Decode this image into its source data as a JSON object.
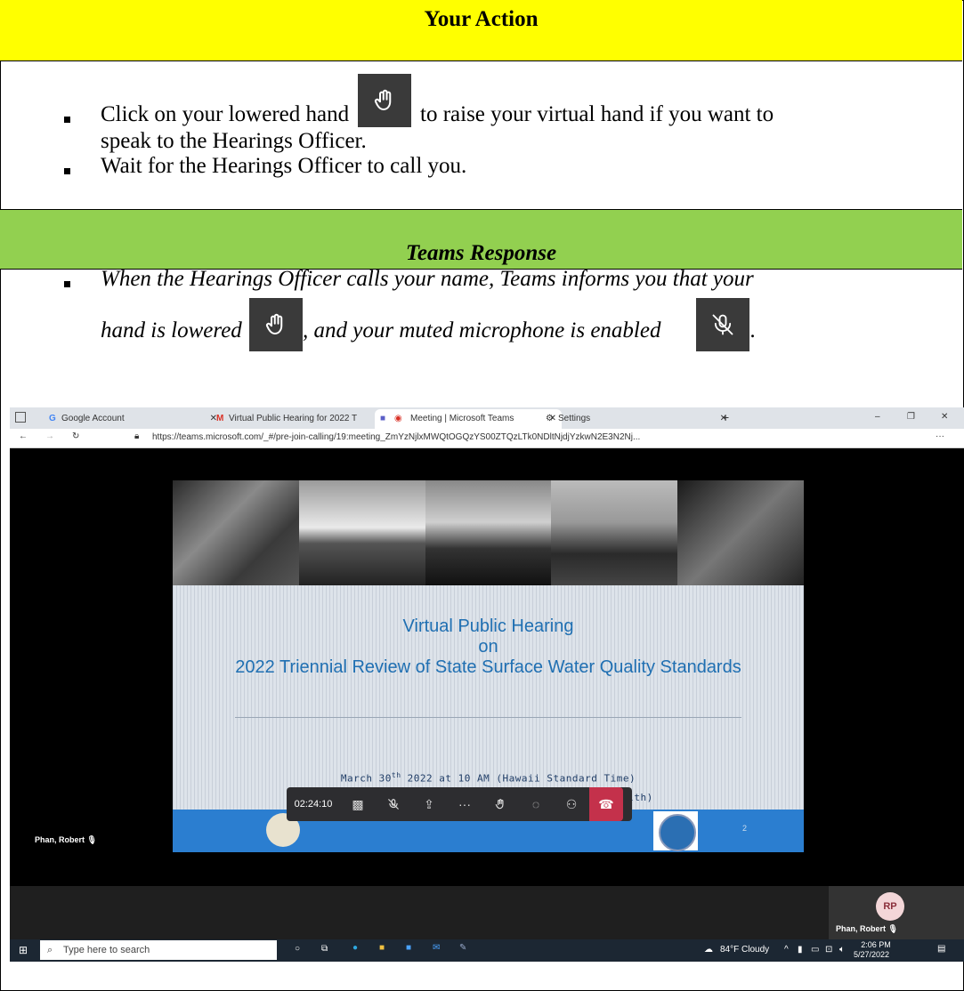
{
  "action": {
    "header": "Your Action",
    "bullet1_part1": "Click on your lowered hand",
    "bullet1_part2": "to raise your virtual hand if you want to",
    "bullet1_line2": "speak to the Hearings Officer.",
    "bullet2": "Wait for the Hearings Officer to call you."
  },
  "response": {
    "header": "Teams Response",
    "line1": "When the Hearings Officer calls your name, Teams informs you that your",
    "line2_part1": "hand is lowered",
    "line2_part2": ", and your muted microphone is enabled",
    "line2_end": "."
  },
  "browser": {
    "tabs": [
      {
        "label": "Google Account"
      },
      {
        "label": "Virtual Public Hearing for 2022 T"
      },
      {
        "label": "Meeting | Microsoft Teams"
      },
      {
        "label": "Settings"
      }
    ],
    "url": "https://teams.microsoft.com/_#/pre-join-calling/19:meeting_ZmYzNjlxMWQtOGQzYS00ZTQzLTk0NDltNjdjYzkwN2E3N2Nj..."
  },
  "slide": {
    "title1": "Virtual Public Hearing",
    "title2": "on",
    "title3": "2022 Triennial Review of State Surface Water Quality Standards",
    "date_pre": "March 30",
    "date_sup": "th",
    "date_post": " 2022 at 10 AM (Hawaii Standard Time)",
    "officiated": "Officiated by Steven Jacobson (Department of Health)",
    "page_num": "2"
  },
  "meeting": {
    "timer": "02:24:10",
    "participant_main": "Phan, Robert",
    "participant_tile": "Phan, Robert",
    "avatar_initials": "RP"
  },
  "taskbar": {
    "search_placeholder": "Type here to search",
    "weather": "84°F  Cloudy",
    "time": "2:06 PM",
    "date": "5/27/2022"
  },
  "colors": {
    "action_header": "#ffff00",
    "response_header": "#92d050",
    "hangup": "#c4314b"
  }
}
